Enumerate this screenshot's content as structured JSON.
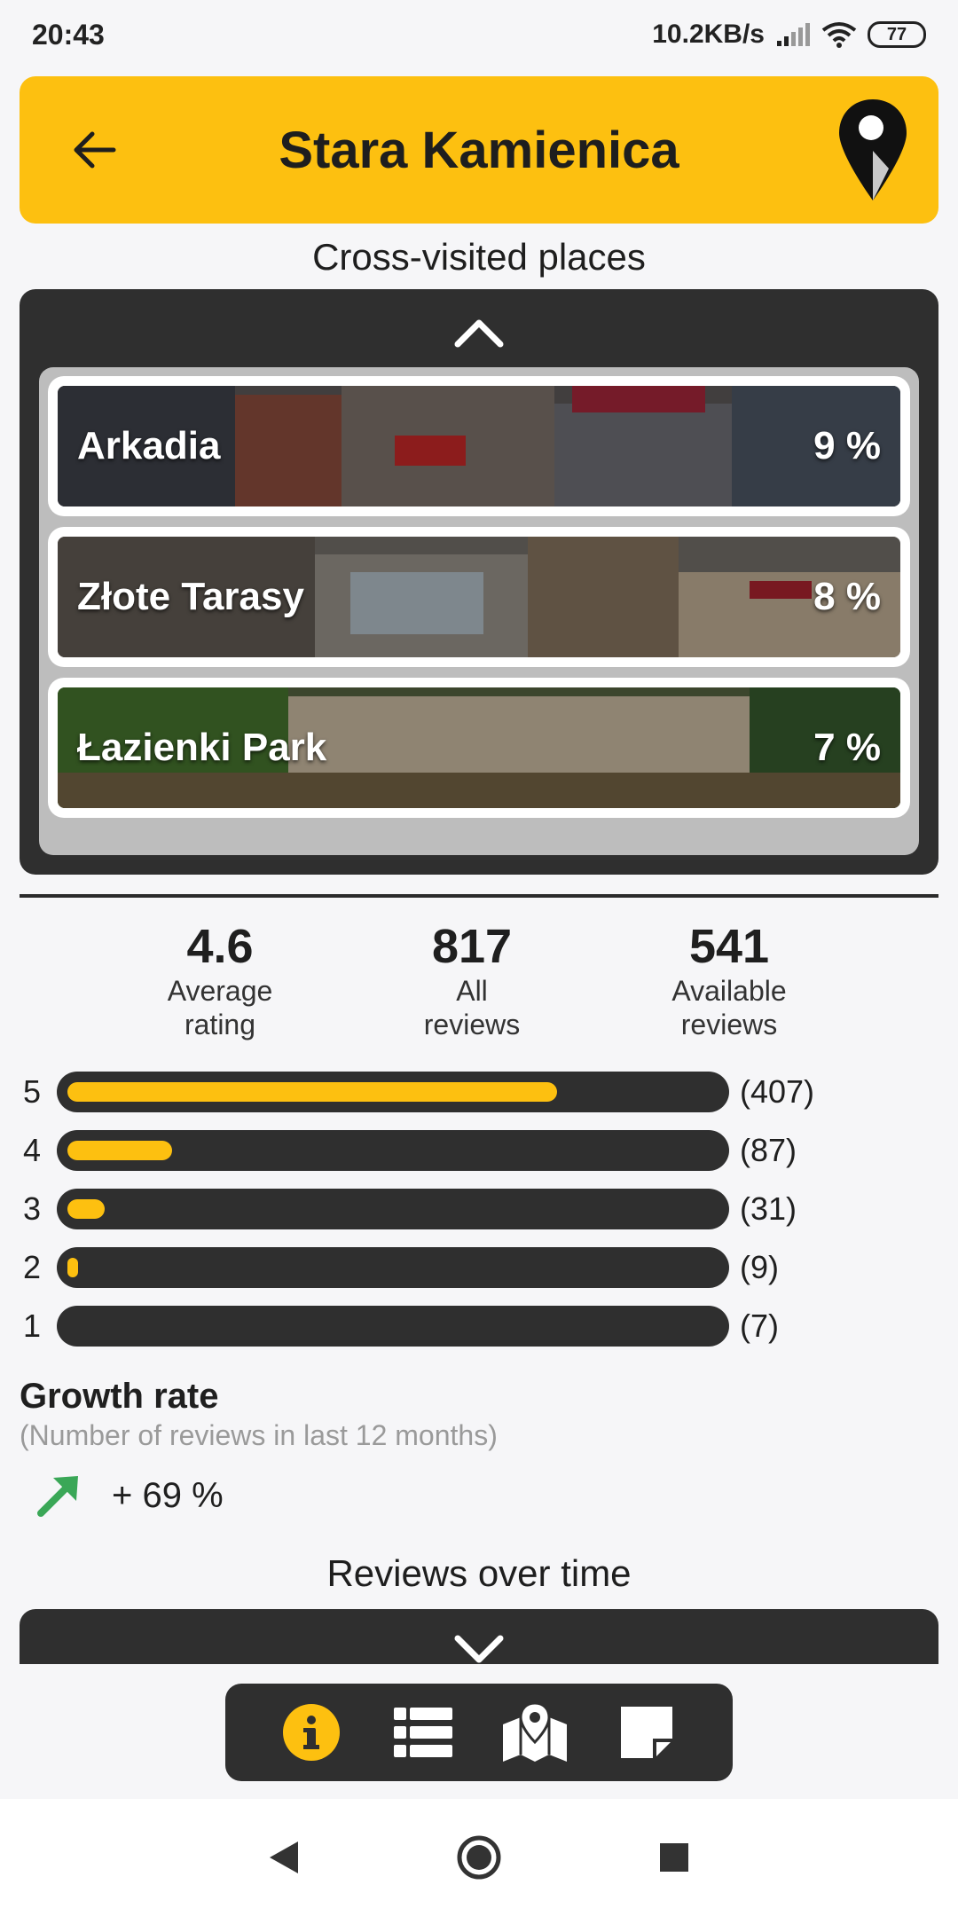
{
  "status_bar": {
    "time": "20:43",
    "network_speed": "10.2KB/s",
    "battery": "77",
    "icons": [
      "signal-icon",
      "wifi-icon",
      "battery-icon"
    ]
  },
  "header": {
    "title": "Stara Kamienica",
    "back_icon": "arrow-left-icon",
    "logo_icon": "map-pin-icon",
    "color": "#fdc010"
  },
  "cross_visited": {
    "title": "Cross-visited places",
    "collapse_icon": "chevron-up-icon",
    "places": [
      {
        "name": "Arkadia",
        "percent": "9 %"
      },
      {
        "name": "Złote Tarasy",
        "percent": "8 %"
      },
      {
        "name": "Łazienki Park",
        "percent": "7 %"
      }
    ]
  },
  "stats": {
    "average_rating": {
      "value": "4.6",
      "label_line1": "Average",
      "label_line2": "rating"
    },
    "all_reviews": {
      "value": "817",
      "label_line1": "All",
      "label_line2": "reviews"
    },
    "available_reviews": {
      "value": "541",
      "label_line1": "Available",
      "label_line2": "reviews"
    }
  },
  "rating_distribution": [
    {
      "stars": "5",
      "count_label": "(407)",
      "count": 407
    },
    {
      "stars": "4",
      "count_label": "(87)",
      "count": 87
    },
    {
      "stars": "3",
      "count_label": "(31)",
      "count": 31
    },
    {
      "stars": "2",
      "count_label": "(9)",
      "count": 9
    },
    {
      "stars": "1",
      "count_label": "(7)",
      "count": 7
    }
  ],
  "growth": {
    "title": "Growth rate",
    "subtitle": "(Number of reviews in last 12 months)",
    "value": "+ 69 %",
    "icon": "trending-up-arrow-icon",
    "color": "#3aa757"
  },
  "reviews_over_time": {
    "title": "Reviews over time",
    "expand_icon": "chevron-down-icon"
  },
  "tab_bar": {
    "tabs": [
      {
        "icon": "info-icon",
        "active": true
      },
      {
        "icon": "list-icon",
        "active": false
      },
      {
        "icon": "map-icon",
        "active": false
      },
      {
        "icon": "note-icon",
        "active": false
      }
    ],
    "accent": "#fdc010"
  },
  "nav_bar": {
    "buttons": [
      "back-triangle-icon",
      "home-circle-icon",
      "recents-square-icon"
    ]
  }
}
